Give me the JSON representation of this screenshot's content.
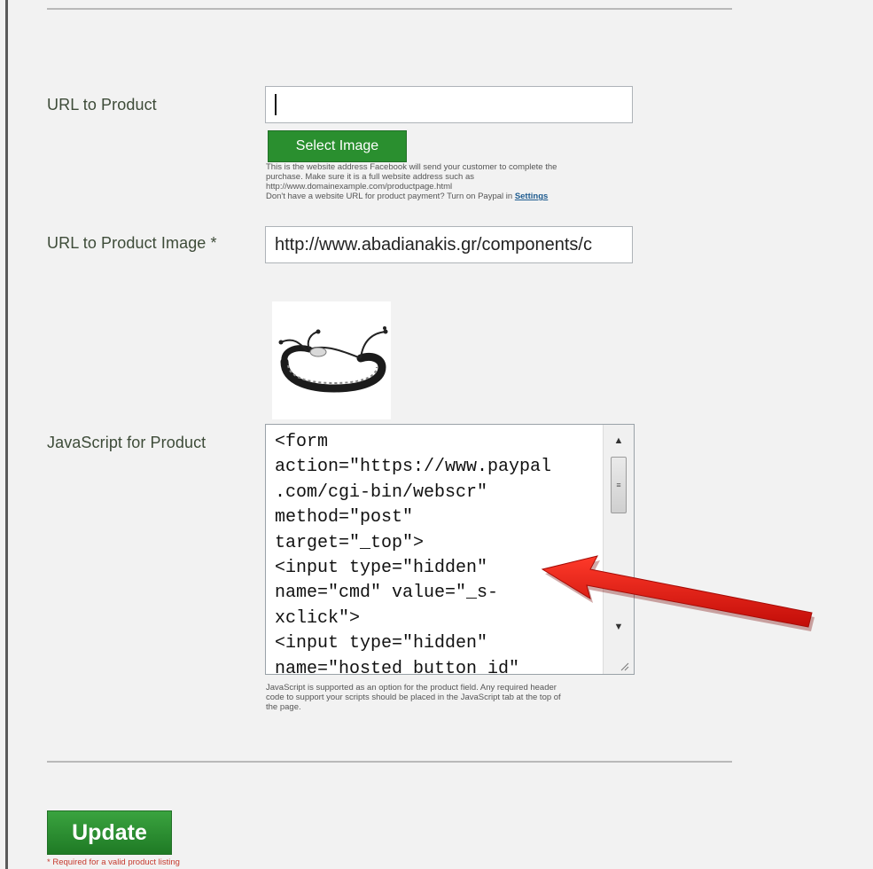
{
  "form": {
    "url_product": {
      "label": "URL to Product",
      "value": ""
    },
    "select_image_label": "Select Image",
    "url_help": [
      "This is the website address Facebook will send your customer to complete the",
      "purchase. Make sure it is a full website address such as",
      "http://www.domainexample.com/productpage.html",
      "Don't have a website URL for product payment? Turn on Paypal in"
    ],
    "settings_link": "Settings",
    "url_image": {
      "label": "URL to Product Image *",
      "value": "http://www.abadianakis.gr/components/c"
    },
    "javascript": {
      "label": "JavaScript for Product",
      "value": "<form\naction=\"https://www.paypal\n.com/cgi-bin/webscr\"\nmethod=\"post\"\ntarget=\"_top\">\n<input type=\"hidden\"\nname=\"cmd\" value=\"_s-\nxclick\">\n<input type=\"hidden\"\nname=\"hosted_button_id\"",
      "help": [
        "JavaScript is supported as an option for the product field. Any required header",
        "code to support your scripts should be placed in the JavaScript tab at the top of",
        "the page."
      ]
    },
    "update_label": "Update",
    "required_note": "* Required for a valid product listing"
  },
  "colors": {
    "button_green": "#2a8f2f",
    "arrow_red": "#e3150f",
    "label_text": "#3d4b38",
    "note_red": "#c53a2e"
  },
  "icons": [
    "scroll-up-arrow-icon",
    "scroll-down-arrow-icon",
    "scroll-grip-icon",
    "resize-grip-icon",
    "red-arrow-annotation"
  ]
}
